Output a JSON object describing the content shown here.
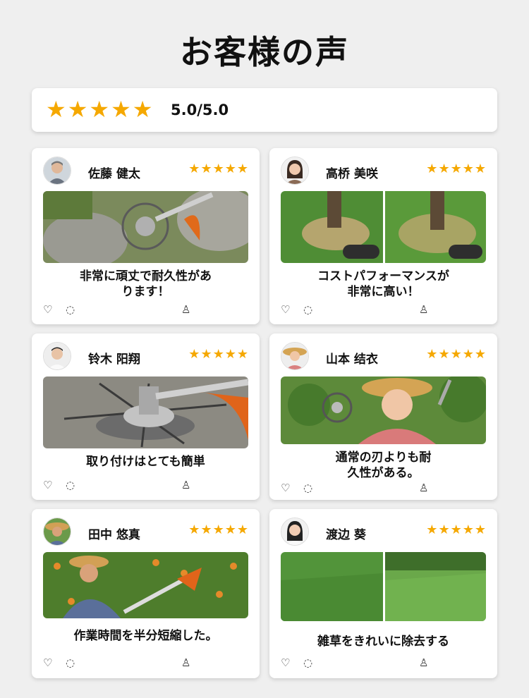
{
  "page": {
    "title": "お客様の声"
  },
  "overall": {
    "stars": 5,
    "score_text": "5.0/5.0",
    "star_color": "#f5a800"
  },
  "reviews": [
    {
      "name": "佐藤 健太",
      "stars": 5,
      "comment": "非常に頑丈で耐久性があ\nります！",
      "photo_desc_icon": "trimmer-blade-on-rocks"
    },
    {
      "name": "高桥 美咲",
      "stars": 5,
      "comment": "コストパフォーマンスが\n非常に高い！",
      "photo_desc_icon": "before-after-tree-lawn"
    },
    {
      "name": "铃木 阳翔",
      "stars": 5,
      "comment": "取り付けはとても簡単",
      "photo_desc_icon": "wire-blade-closeup"
    },
    {
      "name": "山本 结衣",
      "stars": 5,
      "comment": "通常の刃よりも耐\n久性がある。",
      "photo_desc_icon": "woman-with-blade"
    },
    {
      "name": "田中 悠真",
      "stars": 5,
      "comment": "作業時間を半分短縮した。",
      "photo_desc_icon": "man-trimming-orchard"
    },
    {
      "name": "渡边 葵",
      "stars": 5,
      "comment": "雑草をきれいに除去する",
      "photo_desc_icon": "before-after-grass"
    }
  ],
  "icons": {
    "heart": "♡",
    "chat": "💬",
    "thumb": "👍",
    "star": "★"
  }
}
